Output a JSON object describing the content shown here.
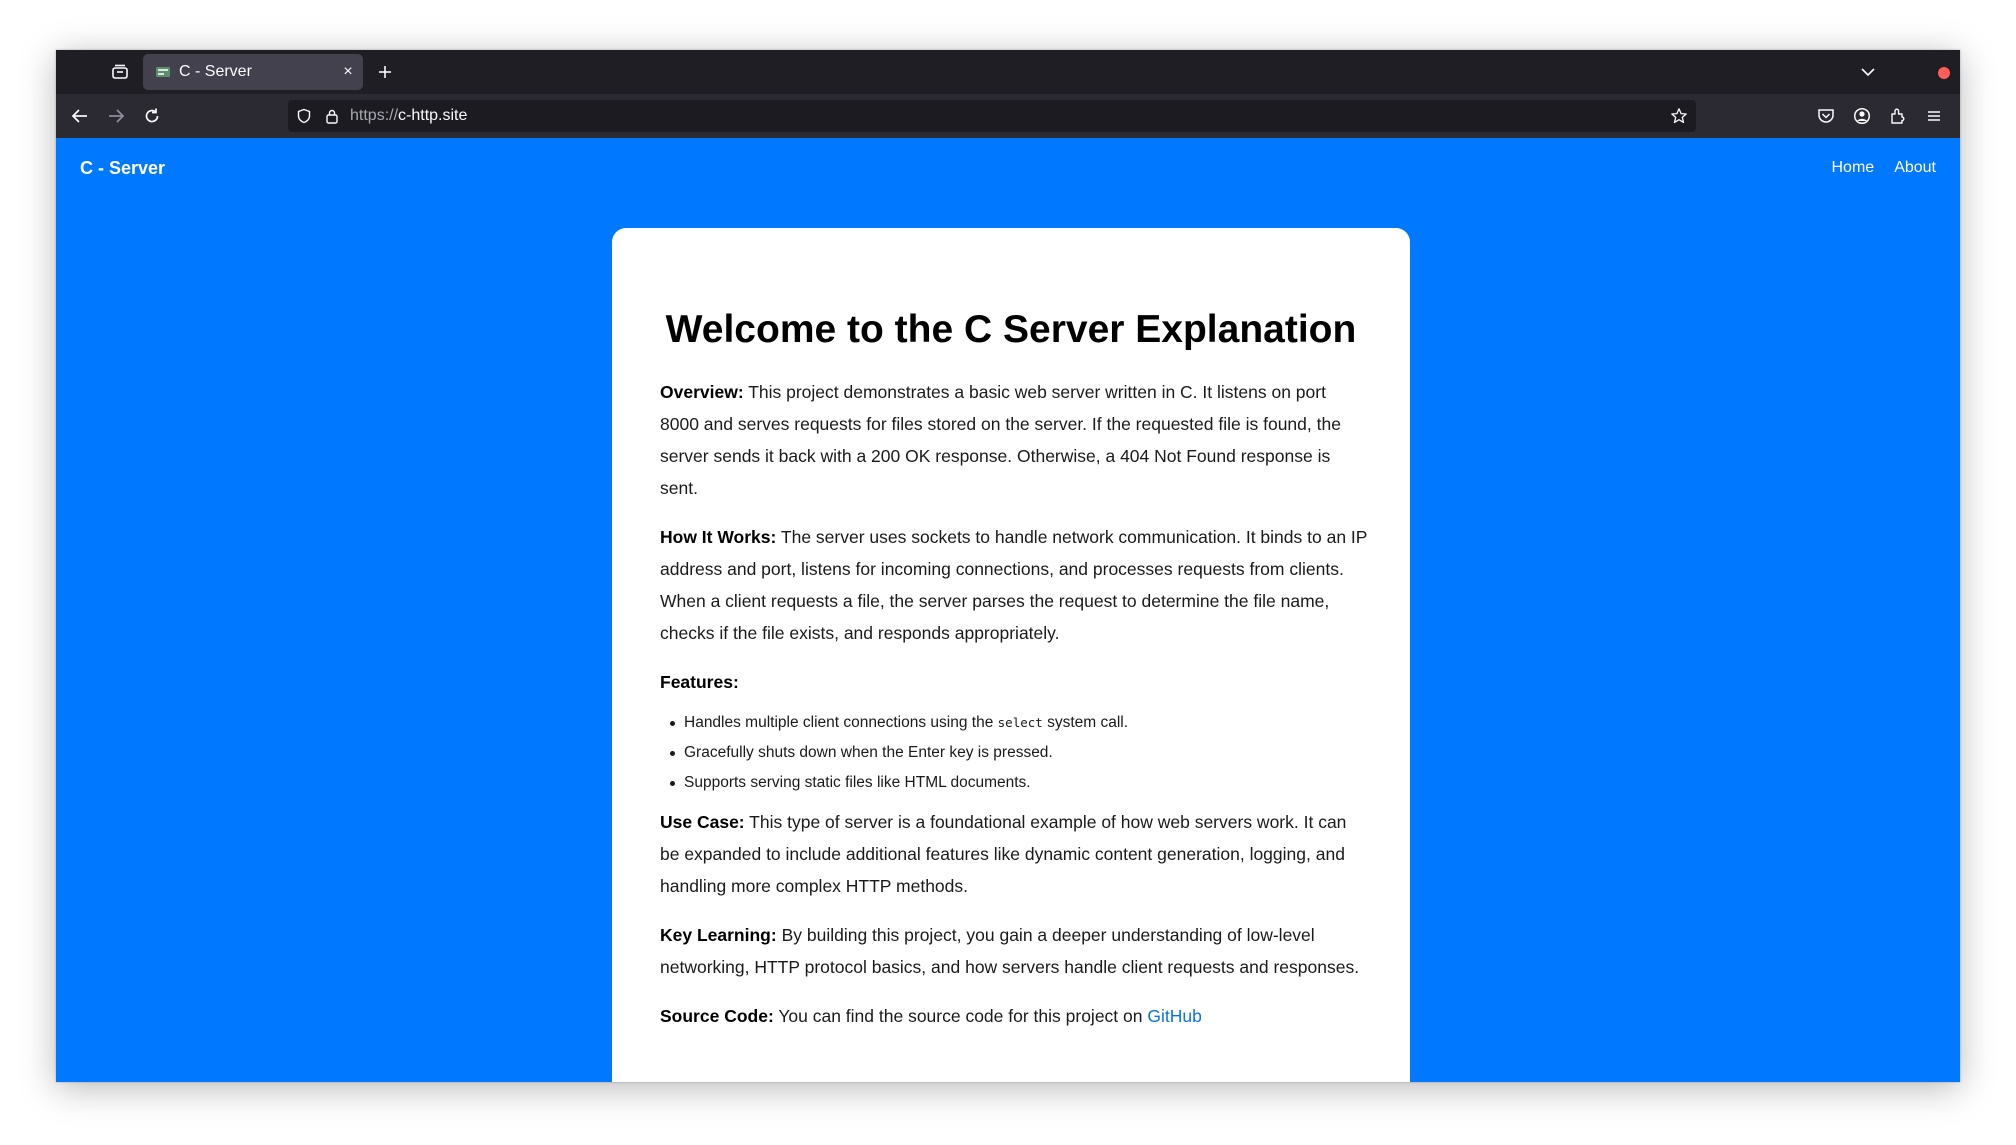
{
  "browser": {
    "tab": {
      "title": "C - Server",
      "close_glyph": "×"
    },
    "url": {
      "scheme": "https://",
      "host": "c-http.site"
    },
    "icons": {
      "tab_overview": "tab-overview-icon",
      "new_tab": "plus-icon",
      "tab_list": "chevron-down-icon",
      "back": "back-arrow-icon",
      "forward": "forward-arrow-icon",
      "reload": "reload-icon",
      "shield": "shield-icon",
      "lock": "lock-icon",
      "bookmark": "star-icon",
      "pocket": "pocket-icon",
      "account": "account-icon",
      "extensions": "extensions-icon",
      "menu": "hamburger-menu-icon"
    },
    "colors": {
      "accent_dot": "#ff5f57"
    }
  },
  "site": {
    "brand": "C - Server",
    "nav": [
      "Home",
      "About"
    ],
    "background": "#0078ff"
  },
  "content": {
    "title": "Welcome to the C Server Explanation",
    "overview": {
      "label": "Overview:",
      "text": " This project demonstrates a basic web server written in C. It listens on port 8000 and serves requests for files stored on the server. If the requested file is found, the server sends it back with a 200 OK response. Otherwise, a 404 Not Found response is sent."
    },
    "how_it_works": {
      "label": "How It Works:",
      "text": " The server uses sockets to handle network communication. It binds to an IP address and port, listens for incoming connections, and processes requests from clients. When a client requests a file, the server parses the request to determine the file name, checks if the file exists, and responds appropriately."
    },
    "features": {
      "label": "Features:",
      "item1_before": "Handles multiple client connections using the ",
      "item1_code": "select",
      "item1_after": " system call.",
      "item2": "Gracefully shuts down when the Enter key is pressed.",
      "item3": "Supports serving static files like HTML documents."
    },
    "use_case": {
      "label": "Use Case:",
      "text": " This type of server is a foundational example of how web servers work. It can be expanded to include additional features like dynamic content generation, logging, and handling more complex HTTP methods."
    },
    "key_learning": {
      "label": "Key Learning:",
      "text": " By building this project, you gain a deeper understanding of low-level networking, HTTP protocol basics, and how servers handle client requests and responses."
    },
    "source_code": {
      "label": "Source Code:",
      "text": " You can find the source code for this project on ",
      "link": "GitHub"
    }
  }
}
